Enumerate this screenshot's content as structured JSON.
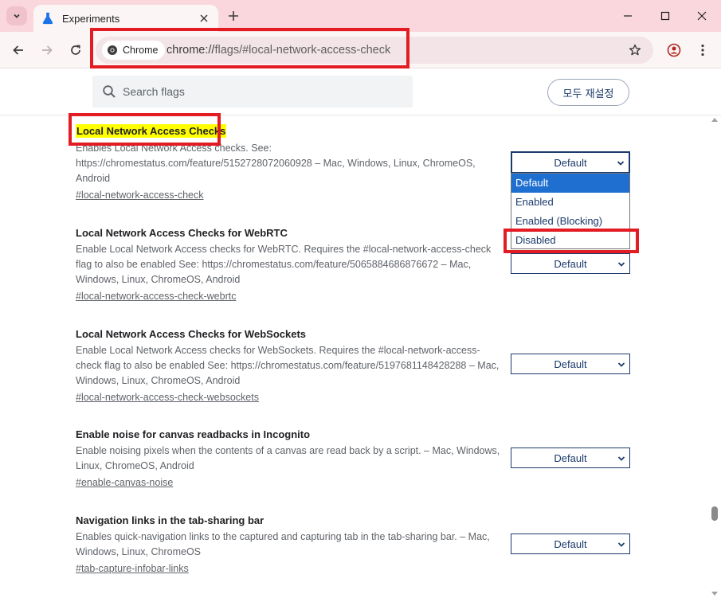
{
  "browser": {
    "tab_title": "Experiments",
    "chip_label": "Chrome",
    "url_scheme": "chrome://",
    "url_path": "flags/#local-network-access-check"
  },
  "flags_page": {
    "search_placeholder": "Search flags",
    "reset_button_label": "모두 재설정"
  },
  "flags": [
    {
      "name": "Local Network Access Checks",
      "description": "Enables Local Network Access checks. See: https://chromestatus.com/feature/5152728072060928 – Mac, Windows, Linux, ChromeOS, Android",
      "anchor": "#local-network-access-check",
      "value": "Default",
      "highlighted": true
    },
    {
      "name": "Local Network Access Checks for WebRTC",
      "description": "Enable Local Network Access checks for WebRTC. Requires the #local-network-access-check flag to also be enabled See: https://chromestatus.com/feature/5065884686876672 – Mac, Windows, Linux, ChromeOS, Android",
      "anchor": "#local-network-access-check-webrtc",
      "value": "Default"
    },
    {
      "name": "Local Network Access Checks for WebSockets",
      "description": "Enable Local Network Access checks for WebSockets. Requires the #local-network-access-check flag to also be enabled See: https://chromestatus.com/feature/5197681148428288 – Mac, Windows, Linux, ChromeOS, Android",
      "anchor": "#local-network-access-check-websockets",
      "value": "Default"
    },
    {
      "name": "Enable noise for canvas readbacks in Incognito",
      "description": "Enable noising pixels when the contents of a canvas are read back by a script. – Mac, Windows, Linux, ChromeOS, Android",
      "anchor": "#enable-canvas-noise",
      "value": "Default"
    },
    {
      "name": "Navigation links in the tab-sharing bar",
      "description": "Enables quick-navigation links to the captured and capturing tab in the tab-sharing bar. – Mac, Windows, Linux, ChromeOS",
      "anchor": "#tab-capture-infobar-links",
      "value": "Default"
    }
  ],
  "dropdown": {
    "options": [
      "Default",
      "Enabled",
      "Enabled (Blocking)",
      "Disabled"
    ],
    "highlighted_option": "Default"
  },
  "colors": {
    "annotation": "#e31b23",
    "highlight": "#ffff00",
    "tabstrip": "#f9d7dc",
    "select_text": "#1a3a6b",
    "selected_option": "#1f6fd1"
  }
}
